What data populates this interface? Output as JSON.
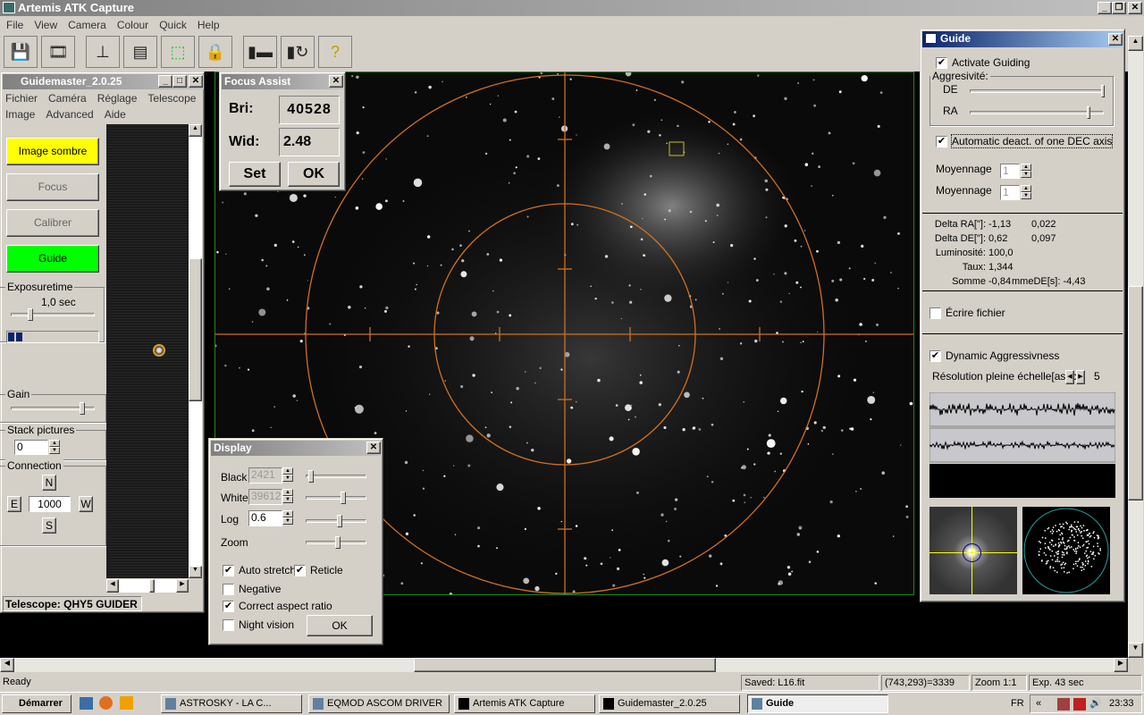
{
  "app": {
    "title": "Artemis ATK Capture",
    "menu": [
      "File",
      "View",
      "Camera",
      "Colour",
      "Quick",
      "Help"
    ],
    "toolbar_icons": [
      "save-icon",
      "save-sequence-icon",
      "exposure-slider-icon",
      "histogram-table-icon",
      "subframe-icon",
      "lock-icon",
      "camera-connect-icon",
      "camera-reconnect-icon",
      "help-icon"
    ]
  },
  "guidemaster": {
    "title": "Guidemaster_2.0.25",
    "menu1": [
      "Fichier",
      "Caméra",
      "Réglage",
      "Telescope"
    ],
    "menu2": [
      "Image",
      "Advanced",
      "Aide"
    ],
    "buttons": {
      "dark": "Image sombre",
      "focus": "Focus",
      "calibrate": "Calibrer",
      "guide": "Guide"
    },
    "exposure_label": "Exposuretime",
    "exposure_value": "1,0 sec",
    "gain_label": "Gain",
    "stack_label": "Stack pictures",
    "stack_value": "0",
    "connection_label": "Connection",
    "n": "N",
    "e": "E",
    "w": "W",
    "s": "S",
    "pulse": "1000",
    "telescope": "Telescope: QHY5 GUIDER",
    "colors": {
      "dark": "#ffff00",
      "guide": "#00ff00"
    }
  },
  "focus_assist": {
    "title": "Focus Assist",
    "bri_label": "Bri:",
    "bri": "40528",
    "wid_label": "Wid:",
    "wid": "2.48",
    "set": "Set",
    "ok": "OK"
  },
  "display": {
    "title": "Display",
    "black_label": "Black",
    "black": "2421",
    "white_label": "White",
    "white": "39612",
    "log_label": "Log",
    "log": "0.6",
    "zoom_label": "Zoom",
    "auto_stretch": "Auto stretch",
    "reticle": "Reticle",
    "negative": "Negative",
    "aspect": "Correct aspect ratio",
    "night": "Night vision",
    "ok": "OK",
    "checked": {
      "auto_stretch": true,
      "reticle": true,
      "negative": false,
      "aspect": true,
      "night": false
    }
  },
  "guide": {
    "title": "Guide",
    "activate": "Activate Guiding",
    "aggr": "Aggresivité:",
    "de": "DE",
    "ra": "RA",
    "auto_deact": "Automatic deact. of one DEC axis",
    "moy1": "Moyennage",
    "moy1_val": "1",
    "moy2": "Moyennage",
    "moy2_val": "1",
    "stats": [
      {
        "label": "Delta RA[\"]:",
        "v1": "-1,13",
        "v2": "0,022"
      },
      {
        "label": "Delta DE[\"]:",
        "v1": "0,62",
        "v2": "0,097"
      },
      {
        "label": "Luminosité:",
        "v1": "100,0",
        "v2": ""
      },
      {
        "label": "Taux:",
        "v1": "1,344",
        "v2": ""
      },
      {
        "label": "Somme",
        "v1": "-0,84",
        "v2": "mmeDE[s]:  -4,43"
      }
    ],
    "write_file": "Écrire fichier",
    "dynamic": "Dynamic Aggressivness",
    "resolution": "Résolution pleine échelle[asec]:",
    "resolution_value": "5"
  },
  "status": {
    "ready": "Ready",
    "saved": "Saved: L16.fit",
    "pixel": "(743,293)=3339",
    "zoom": "Zoom 1:1",
    "exp": "Exp. 43 sec"
  },
  "taskbar": {
    "start": "Démarrer",
    "items": [
      "ASTROSKY    -    LA C...",
      "EQMOD ASCOM DRIVER",
      "Artemis ATK Capture",
      "Guidemaster_2.0.25",
      "Guide"
    ],
    "lang": "FR",
    "time": "23:33"
  },
  "reticle_color": "#d07020"
}
